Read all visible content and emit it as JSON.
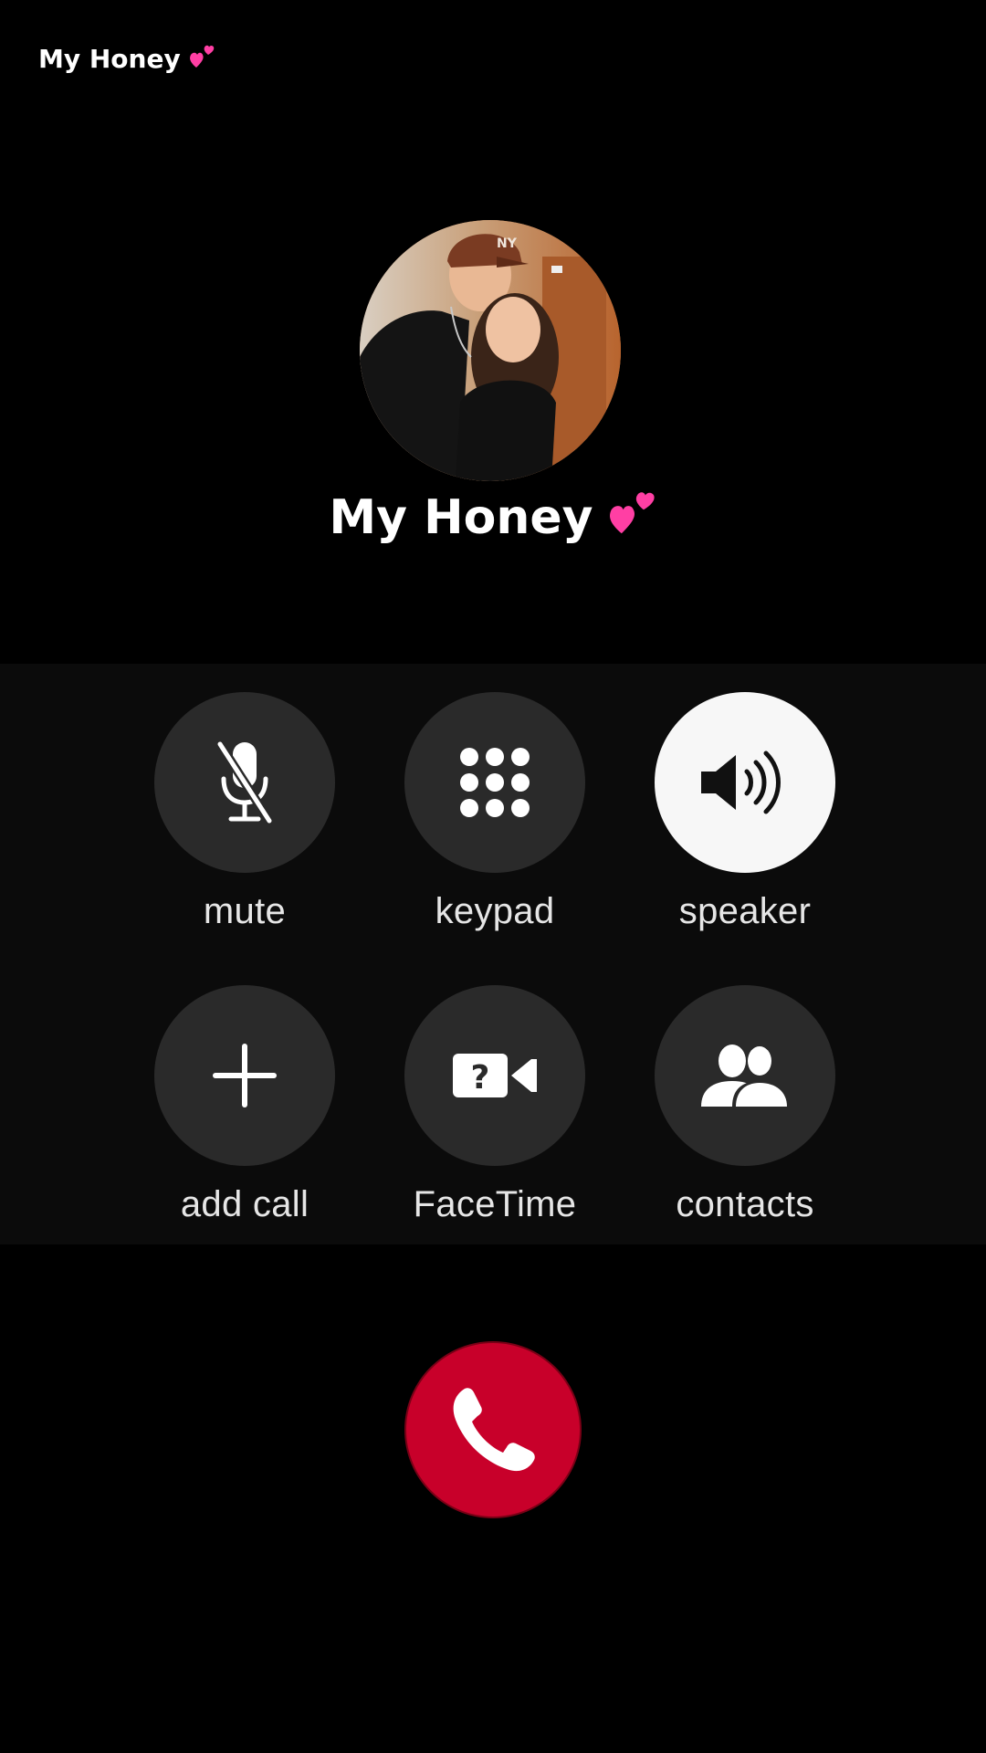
{
  "header": {
    "caller_label": "My Honey",
    "caller_emoji": "💕"
  },
  "caller": {
    "name": "My Honey",
    "emoji": "💕"
  },
  "controls": {
    "mute": {
      "label": "mute",
      "icon": "mic-slash-icon"
    },
    "keypad": {
      "label": "keypad",
      "icon": "keypad-icon"
    },
    "speaker": {
      "label": "speaker",
      "icon": "speaker-wave-icon",
      "active": true
    },
    "add_call": {
      "label": "add call",
      "icon": "plus-icon"
    },
    "facetime": {
      "label": "FaceTime",
      "icon": "video-question-icon"
    },
    "contacts": {
      "label": "contacts",
      "icon": "people-icon"
    }
  },
  "end_call": {
    "icon": "phone-hangup-icon"
  },
  "colors": {
    "background": "#000000",
    "panel": "#0b0b0b",
    "button": "#2a2a2a",
    "button_active": "#f7f7f7",
    "end_call": "#c8002a",
    "heart": "#ff3fa4"
  }
}
